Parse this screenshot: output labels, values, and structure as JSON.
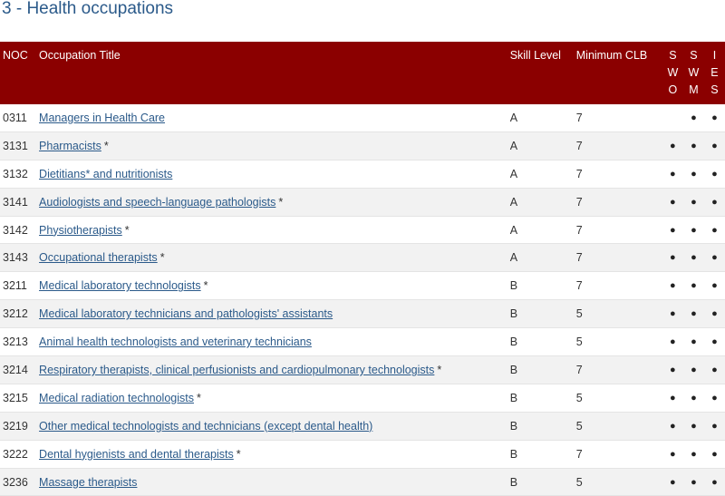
{
  "page": {
    "title": "3 - Health occupations"
  },
  "table": {
    "headers": {
      "noc": "NOC",
      "title": "Occupation Title",
      "skill": "Skill Level",
      "clb": "Minimum CLB",
      "swo": [
        "S",
        "W",
        "O"
      ],
      "swm": [
        "S",
        "W",
        "M"
      ],
      "ies": [
        "I",
        "E",
        "S"
      ]
    },
    "rows": [
      {
        "noc": "0311",
        "title": "Managers in Health Care",
        "asterisk": "",
        "skill": "A",
        "clb": "7",
        "swo": "",
        "swm": "●",
        "ies": "●"
      },
      {
        "noc": "3131",
        "title": "Pharmacists",
        "asterisk": "*",
        "skill": "A",
        "clb": "7",
        "swo": "●",
        "swm": "●",
        "ies": "●"
      },
      {
        "noc": "3132",
        "title": "Dietitians* and nutritionists",
        "asterisk": "",
        "skill": "A",
        "clb": "7",
        "swo": "●",
        "swm": "●",
        "ies": "●"
      },
      {
        "noc": "3141",
        "title": "Audiologists and speech-language pathologists",
        "asterisk": "*",
        "skill": "A",
        "clb": "7",
        "swo": "●",
        "swm": "●",
        "ies": "●"
      },
      {
        "noc": "3142",
        "title": "Physiotherapists",
        "asterisk": "*",
        "skill": "A",
        "clb": "7",
        "swo": "●",
        "swm": "●",
        "ies": "●"
      },
      {
        "noc": "3143",
        "title": "Occupational therapists",
        "asterisk": "*",
        "skill": "A",
        "clb": "7",
        "swo": "●",
        "swm": "●",
        "ies": "●"
      },
      {
        "noc": "3211",
        "title": "Medical laboratory technologists",
        "asterisk": "*",
        "skill": "B",
        "clb": "7",
        "swo": "●",
        "swm": "●",
        "ies": "●"
      },
      {
        "noc": "3212",
        "title": "Medical laboratory technicians and pathologists' assistants",
        "asterisk": "",
        "skill": "B",
        "clb": "5",
        "swo": "●",
        "swm": "●",
        "ies": "●"
      },
      {
        "noc": "3213",
        "title": "Animal health technologists and veterinary technicians",
        "asterisk": "",
        "skill": "B",
        "clb": "5",
        "swo": "●",
        "swm": "●",
        "ies": "●"
      },
      {
        "noc": "3214",
        "title": "Respiratory therapists, clinical perfusionists and cardiopulmonary technologists",
        "asterisk": "*",
        "skill": "B",
        "clb": "7",
        "swo": "●",
        "swm": "●",
        "ies": "●"
      },
      {
        "noc": "3215",
        "title": "Medical radiation technologists",
        "asterisk": "*",
        "skill": "B",
        "clb": "5",
        "swo": "●",
        "swm": "●",
        "ies": "●"
      },
      {
        "noc": "3219",
        "title": "Other medical technologists and technicians (except dental health)",
        "asterisk": "",
        "skill": "B",
        "clb": "5",
        "swo": "●",
        "swm": "●",
        "ies": "●"
      },
      {
        "noc": "3222",
        "title": "Dental hygienists and dental therapists",
        "asterisk": "*",
        "skill": "B",
        "clb": "7",
        "swo": "●",
        "swm": "●",
        "ies": "●"
      },
      {
        "noc": "3236",
        "title": "Massage therapists",
        "asterisk": "",
        "skill": "B",
        "clb": "5",
        "swo": "●",
        "swm": "●",
        "ies": "●"
      }
    ]
  },
  "colors": {
    "header_bg": "#8b0000",
    "link": "#2b5a8a",
    "title": "#2b5a8a",
    "stripe": "#f2f2f2"
  }
}
